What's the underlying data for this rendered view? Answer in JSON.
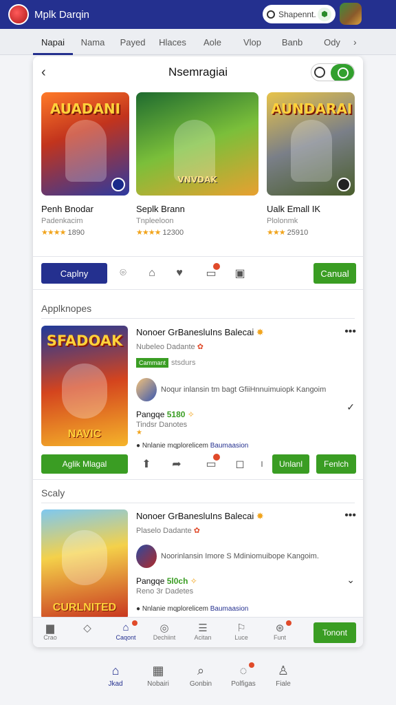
{
  "app": {
    "title": "Mplk Darqin",
    "search_placeholder": "Shapennt."
  },
  "tabs": [
    "Napai",
    "Nama",
    "Payed",
    "Hlaces",
    "Aole",
    "Vlop",
    "Banb",
    "Ody"
  ],
  "card": {
    "title": "Nsemragiai",
    "featured": [
      {
        "thumb_text": "AUADANI",
        "name": "Penh Bnodar",
        "sub": "Padenkacim",
        "stars": "★★★★",
        "rating": "1890"
      },
      {
        "thumb_text": "VNVDAK",
        "name": "Seplk Brann",
        "sub": "Tnpleeloon",
        "stars": "★★★★",
        "rating": "12300"
      },
      {
        "thumb_text": "AUNDARAI",
        "name": "Ualk Emall IK",
        "sub": "Plolonmk",
        "stars": "★★★",
        "rating": "25910"
      }
    ],
    "actions": {
      "primary": "Caplny",
      "secondary": "Canual"
    }
  },
  "sections": [
    {
      "label": "Applknopes",
      "thumb_text_top": "SFADOAK",
      "thumb_text_bottom": "NAVIC",
      "name": "Nonoer GrBanesluIns Balecai",
      "sub": "Nubeleo Dadante",
      "tag": "Cammant",
      "status": "stsdurs",
      "desc": "Noqur inlansin tm bagt GfiiHnnuimuiopk Kangoim",
      "price_label": "Pangqe",
      "price_value": "5180",
      "price_sub": "Tindsr Danotes",
      "meta": "Nnlanie mqplorelicem",
      "meta_link": "Baumaasion",
      "buttons": {
        "primary": "Aglik Mlagal",
        "b2": "Unlanl",
        "b3": "Fenlch"
      }
    },
    {
      "label": "Scaly",
      "thumb_text_top": "",
      "thumb_text_bottom": "CURLNITED",
      "name": "Nonoer GrBanesluIns Balecai",
      "sub": "Plaselo Dadante",
      "desc": "Noorinlansin Imore S Mdiniomuibope Kangoim.",
      "price_label": "Pangqe",
      "price_value": "5l0ch",
      "price_sub": "Reno 3r Dadetes",
      "meta": "Nnlanie mqplorelicem",
      "meta_link": "Baumaasion"
    }
  ],
  "inner_nav": [
    {
      "icon": "chat-icon",
      "label": "Crao"
    },
    {
      "icon": "diamond-icon",
      "label": ""
    },
    {
      "icon": "home-icon",
      "label": "Caqont"
    },
    {
      "icon": "badge-icon",
      "label": "Dechiint"
    },
    {
      "icon": "list-icon",
      "label": "Acitan"
    },
    {
      "icon": "flag-icon",
      "label": "Luce"
    },
    {
      "icon": "cart-icon",
      "label": "Funt"
    }
  ],
  "inner_nav_button": "Tonont",
  "bottom_nav": [
    {
      "icon": "home-icon",
      "label": "Jkad"
    },
    {
      "icon": "store-icon",
      "label": "Nobairi"
    },
    {
      "icon": "search-icon",
      "label": "Gonbin"
    },
    {
      "icon": "chat-icon",
      "label": "Polfigas"
    },
    {
      "icon": "user-icon",
      "label": "Fiale"
    }
  ],
  "colors": {
    "primary": "#24308f",
    "accent": "#3a9d23",
    "notify": "#e04a2a",
    "star": "#f1a41c"
  }
}
